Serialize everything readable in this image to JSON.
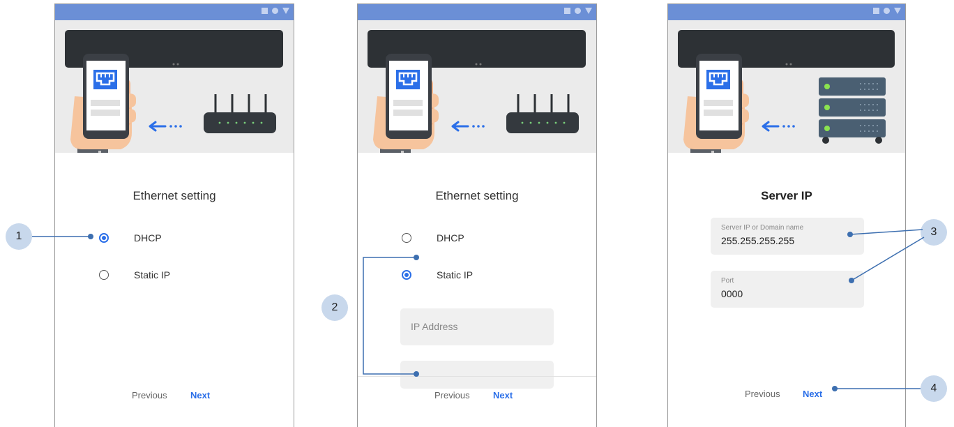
{
  "screens": [
    {
      "title": "Ethernet setting",
      "options": [
        {
          "label": "DHCP",
          "selected": true
        },
        {
          "label": "Static IP",
          "selected": false
        }
      ],
      "buttons": {
        "previous": "Previous",
        "next": "Next"
      }
    },
    {
      "title": "Ethernet setting",
      "options": [
        {
          "label": "DHCP",
          "selected": false
        },
        {
          "label": "Static IP",
          "selected": true
        }
      ],
      "ip_address_placeholder": "IP Address",
      "buttons": {
        "previous": "Previous",
        "next": "Next"
      }
    },
    {
      "title": "Server IP",
      "server_field": {
        "label": "Server IP  or  Domain name",
        "value": "255.255.255.255"
      },
      "port_field": {
        "label": "Port",
        "value": "0000"
      },
      "buttons": {
        "previous": "Previous",
        "next": "Next"
      }
    }
  ],
  "callouts": [
    "1",
    "2",
    "3",
    "4"
  ],
  "colors": {
    "status_bar": "#6b8fd6",
    "accent": "#2b6fe8",
    "callout": "#c8d8ec",
    "connector": "#3d6fb0"
  },
  "icons": [
    "phone-hand-icon",
    "ethernet-port-icon",
    "router-icon",
    "server-rack-icon",
    "arrow-left-icon"
  ]
}
